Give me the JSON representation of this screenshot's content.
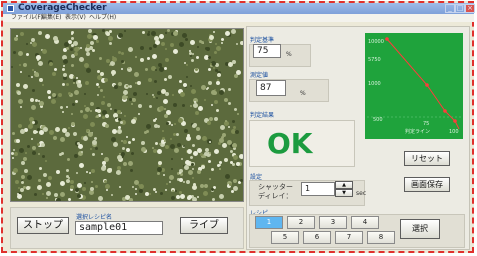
{
  "window": {
    "title": "CoverageChecker"
  },
  "menu": [
    "ファイル(F)",
    "編集(E)",
    "表示(V)",
    "ヘルプ(H)"
  ],
  "controls": {
    "stop_label": "ストップ",
    "recipe_name_label": "選択レシピ名",
    "recipe_name_value": "sample01",
    "live_label": "ライブ"
  },
  "judge": {
    "criterion_label": "判定基準",
    "criterion_value": "75",
    "criterion_unit": "%",
    "measured_label": "測定値",
    "measured_value": "87",
    "measured_unit": "%",
    "result_label": "判定結果",
    "result_value": "OK"
  },
  "graph": {
    "labels": [
      "10000",
      "5750",
      "1000",
      "500",
      "判定ライン",
      "75",
      "100"
    ]
  },
  "buttons": {
    "reset_label": "リセット",
    "save_label": "画面保存",
    "select_label": "選択"
  },
  "settings": {
    "group_label": "設定",
    "shutter_label": "シャッター",
    "delay_label": "ディレイ：",
    "delay_value": "1",
    "delay_unit": "sec"
  },
  "recipe": {
    "group_label": "レシピ",
    "buttons": [
      "1",
      "2",
      "3",
      "4",
      "5",
      "6",
      "7",
      "8"
    ],
    "selected": "1"
  },
  "colors": {
    "ok": "#1c9b3f",
    "graph_bg": "#1fa33c",
    "graph_line": "#ff3b3b",
    "selected_recipe": "#5fb6f0"
  }
}
